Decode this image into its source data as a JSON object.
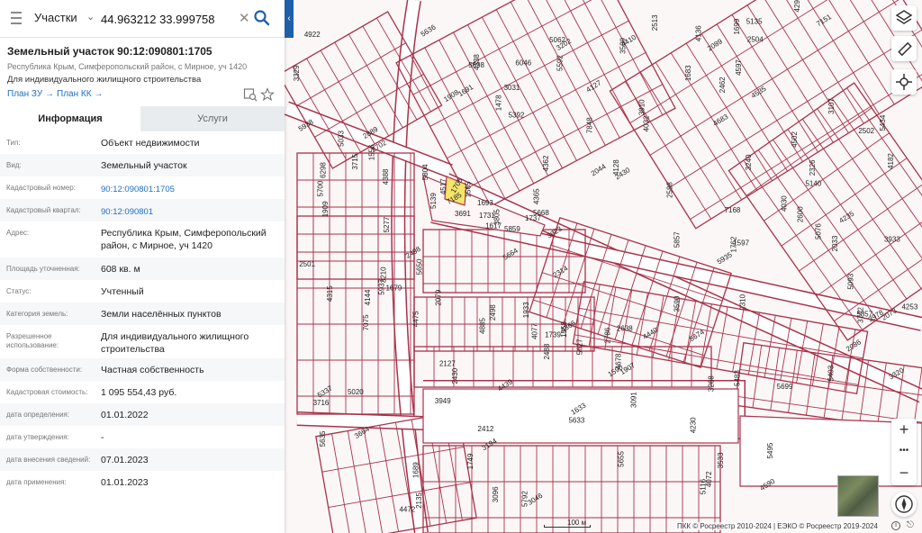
{
  "search": {
    "type_label": "Участки",
    "value": "44.963212 33.999758"
  },
  "object": {
    "title": "Земельный участок 90:12:090801:1705",
    "address_line": "Республика Крым, Симферопольский район, с Мирное, уч 1420",
    "purpose_line": "Для индивидуального жилищного строительства",
    "plan_zu": "План ЗУ →",
    "plan_kk": "План КК →"
  },
  "tabs": [
    "Информация",
    "Услуги"
  ],
  "attributes": [
    {
      "key": "Тип:",
      "value": "Объект недвижимости"
    },
    {
      "key": "Вид:",
      "value": "Земельный участок"
    },
    {
      "key": "Кадастровый номер:",
      "value": "90:12:090801:1705"
    },
    {
      "key": "Кадастровый квартал:",
      "value": "90:12:090801"
    },
    {
      "key": "Адрес:",
      "value": "Республика Крым, Симферопольский район, с Мирное, уч 1420"
    },
    {
      "key": "Площадь уточненная:",
      "value": "608 кв. м"
    },
    {
      "key": "Статус:",
      "value": "Учтенный"
    },
    {
      "key": "Категория земель:",
      "value": "Земли населённых пунктов"
    },
    {
      "key": "Разрешенное использование:",
      "value": "Для индивидуального жилищного строительства"
    },
    {
      "key": "Форма собственности:",
      "value": "Частная собственность"
    },
    {
      "key": "Кадастровая стоимость:",
      "value": "1 095 554,43 руб."
    },
    {
      "key": "дата определения:",
      "value": "01.01.2022"
    },
    {
      "key": "дата утверждения:",
      "value": "-"
    },
    {
      "key": "дата внесения сведений:",
      "value": "07.01.2023"
    },
    {
      "key": "дата применения:",
      "value": "01.01.2023"
    }
  ],
  "map": {
    "scale_label": "100 м",
    "copyright": "ПКК © Росреестр 2010-2024 | ЕЭКО © Росреестр 2019-2024",
    "colors": {
      "parcel_line": "#a8324a",
      "selected_fill": "#f3e46b",
      "road": "#ffffff"
    },
    "parcel_labels": [
      "1705",
      "1693",
      "1731",
      "1737",
      "3691",
      "5139",
      "5668",
      "5859",
      "3664",
      "4922",
      "1478",
      "4388",
      "1691",
      "2502",
      "4885",
      "1689",
      "6046",
      "1908",
      "1907",
      "1933",
      "4597",
      "4315",
      "5116",
      "5857",
      "5937",
      "5277",
      "2079",
      "2310",
      "1749",
      "1739",
      "1590",
      "1617",
      "1565",
      "1683",
      "1699",
      "1558",
      "2089",
      "5699",
      "3031",
      "3805",
      "2702",
      "1633",
      "2462",
      "2086",
      "2033",
      "2412",
      "2638",
      "3949",
      "1597",
      "3329",
      "2430",
      "3978",
      "1556",
      "2889",
      "2430",
      "5698",
      "3716",
      "2314",
      "4440",
      "5135",
      "4235",
      "5655",
      "3240",
      "3742",
      "3533",
      "3910",
      "2504",
      "2498",
      "3320",
      "2501",
      "2326",
      "5700",
      "3268",
      "1762",
      "2488",
      "3107",
      "7185",
      "7151",
      "4030",
      "2073",
      "5636",
      "5938",
      "3023",
      "2600",
      "4502",
      "4678",
      "5635",
      "3589",
      "2513",
      "5020",
      "3590",
      "5592",
      "2127",
      "4362",
      "4590",
      "5483",
      "5664",
      "4072",
      "4439",
      "5633",
      "5495",
      "5627",
      "1679",
      "4182",
      "4136",
      "4366",
      "2588",
      "5062",
      "4144",
      "5140",
      "5403",
      "7075",
      "4338",
      "4127",
      "5650",
      "4032",
      "5337",
      "4475",
      "5434",
      "2498",
      "3091",
      "4683",
      "4365",
      "4517",
      "4253",
      "5935",
      "5357",
      "5674",
      "4410",
      "7168",
      "5076",
      "5804",
      "5033",
      "3046",
      "7848",
      "3210",
      "3202",
      "4299",
      "4077",
      "6298",
      "1909",
      "5093",
      "2135",
      "3933",
      "4472",
      "2786",
      "3096",
      "2044",
      "4535",
      "5792",
      "3715",
      "5392",
      "4128",
      "3194",
      "4230"
    ]
  },
  "controls": {
    "zoom_in": "+",
    "zoom_more": "•••",
    "zoom_out": "−"
  }
}
